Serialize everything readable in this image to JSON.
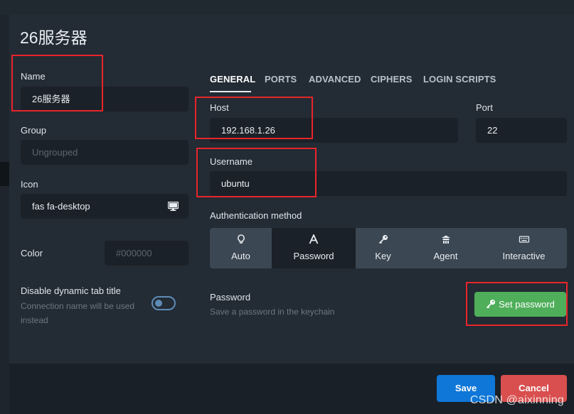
{
  "dialog": {
    "title": "26服务器"
  },
  "left": {
    "name_label": "Name",
    "name_value": "26服务器",
    "group_label": "Group",
    "group_placeholder": "Ungrouped",
    "icon_label": "Icon",
    "icon_value": "fas fa-desktop",
    "color_label": "Color",
    "color_placeholder": "#000000",
    "disable_tab_title_label": "Disable dynamic tab title",
    "disable_tab_title_sub": "Connection name will be used instead",
    "disable_tab_title_enabled": false
  },
  "tabs": [
    {
      "label": "GENERAL",
      "active": true
    },
    {
      "label": "PORTS",
      "active": false
    },
    {
      "label": "ADVANCED",
      "active": false
    },
    {
      "label": "CIPHERS",
      "active": false
    },
    {
      "label": "LOGIN SCRIPTS",
      "active": false
    }
  ],
  "general": {
    "host_label": "Host",
    "host_value": "192.168.1.26",
    "port_label": "Port",
    "port_value": "22",
    "username_label": "Username",
    "username_value": "ubuntu",
    "auth_label": "Authentication method",
    "auth_options": [
      {
        "label": "Auto",
        "icon": "lightbulb-icon",
        "active": false
      },
      {
        "label": "Password",
        "icon": "font-icon",
        "active": true
      },
      {
        "label": "Key",
        "icon": "key-icon",
        "active": false
      },
      {
        "label": "Agent",
        "icon": "agent-icon",
        "active": false
      },
      {
        "label": "Interactive",
        "icon": "keyboard-icon",
        "active": false
      }
    ],
    "password_label": "Password",
    "password_sub": "Save a password in the keychain",
    "set_password_button": "Set password"
  },
  "footer": {
    "save_label": "Save",
    "cancel_label": "Cancel"
  },
  "watermark": "CSDN @aixinning",
  "colors": {
    "background": "#232b34",
    "accent_blue": "#0f77d8",
    "success_green": "#4fae5a",
    "danger_red": "#d94f4f",
    "annotation_red": "#e8252a"
  }
}
